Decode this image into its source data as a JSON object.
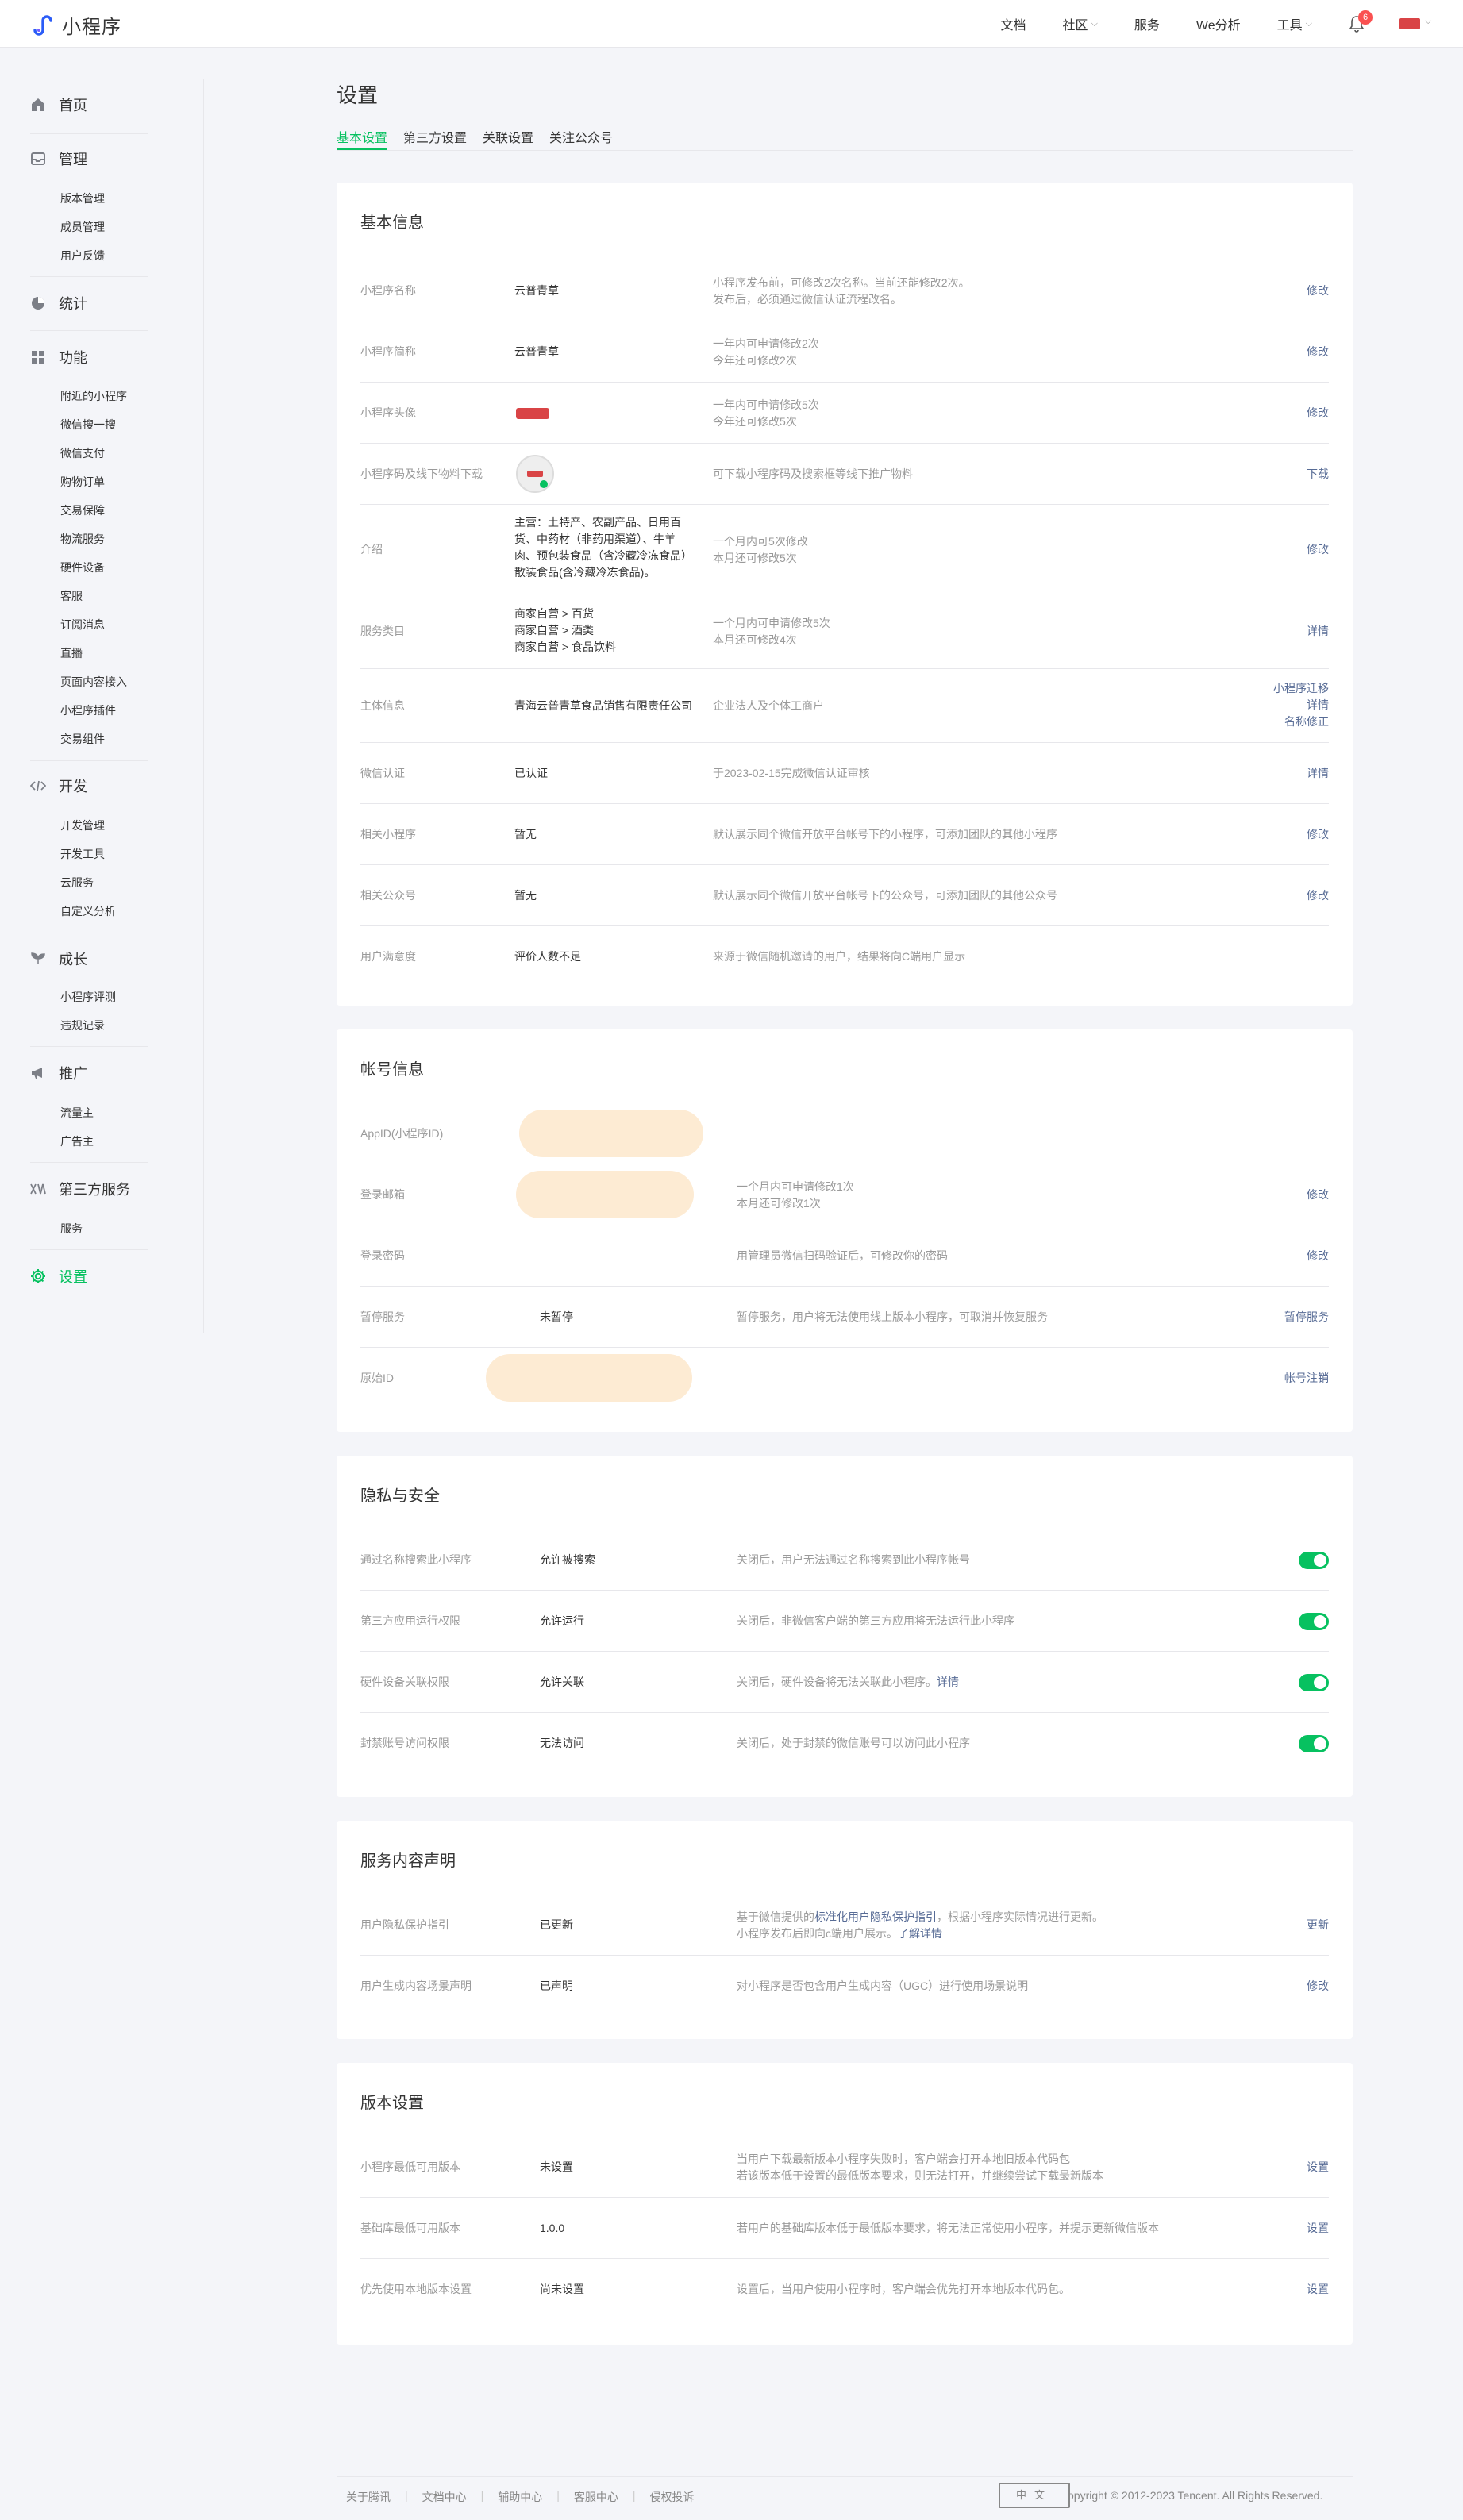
{
  "app": {
    "title": "小程序"
  },
  "topnav": {
    "items": [
      "文档",
      "社区",
      "服务",
      "We分析",
      "工具"
    ],
    "notifications": "6"
  },
  "sidebar": {
    "groups": [
      {
        "label": "首页",
        "icon": "home-icon",
        "items": []
      },
      {
        "label": "管理",
        "icon": "inbox-icon",
        "items": [
          "版本管理",
          "成员管理",
          "用户反馈"
        ]
      },
      {
        "label": "统计",
        "icon": "pie-chart-icon",
        "items": []
      },
      {
        "label": "功能",
        "icon": "grid-icon",
        "items": [
          "附近的小程序",
          "微信搜一搜",
          "微信支付",
          "购物订单",
          "交易保障",
          "物流服务",
          "硬件设备",
          "客服",
          "订阅消息",
          "直播",
          "页面内容接入",
          "小程序插件",
          "交易组件"
        ]
      },
      {
        "label": "开发",
        "icon": "code-icon",
        "items": [
          "开发管理",
          "开发工具",
          "云服务",
          "自定义分析"
        ]
      },
      {
        "label": "成长",
        "icon": "sprout-icon",
        "items": [
          "小程序评测",
          "违规记录"
        ]
      },
      {
        "label": "推广",
        "icon": "megaphone-icon",
        "items": [
          "流量主",
          "广告主"
        ]
      },
      {
        "label": "第三方服务",
        "icon": "puzzle-icon",
        "items": [
          "服务"
        ]
      },
      {
        "label": "设置",
        "icon": "gear-icon",
        "items": []
      }
    ]
  },
  "page": {
    "title": "设置",
    "tabs": [
      "基本设置",
      "第三方设置",
      "关联设置",
      "关注公众号"
    ]
  },
  "basic_info": {
    "title": "基本信息",
    "rows": [
      {
        "label": "小程序名称",
        "value": "云普青草",
        "desc": [
          "小程序发布前，可修改2次名称。当前还能修改2次。",
          "发布后，必须通过微信认证流程改名。"
        ],
        "actions": [
          "修改"
        ]
      },
      {
        "label": "小程序简称",
        "value": "云普青草",
        "desc": [
          "一年内可申请修改2次",
          "今年还可修改2次"
        ],
        "actions": [
          "修改"
        ]
      },
      {
        "label": "小程序头像",
        "value": "",
        "desc": [
          "一年内可申请修改5次",
          "今年还可修改5次"
        ],
        "actions": [
          "修改"
        ]
      },
      {
        "label": "小程序码及线下物料下载",
        "value": "",
        "desc": [
          "可下载小程序码及搜索框等线下推广物料"
        ],
        "actions": [
          "下载"
        ]
      },
      {
        "label": "介绍",
        "value": [
          "主营：土特产、农副产品、日用百",
          "货、中药材（非药用渠道）、牛羊",
          "肉、预包装食品（含冷藏冷冻食品）",
          "散装食品(含冷藏冷冻食品)。"
        ],
        "desc": [
          "一个月内可5次修改",
          "本月还可修改5次"
        ],
        "actions": [
          "修改"
        ]
      },
      {
        "label": "服务类目",
        "value": [
          "商家自营 > 百货",
          "商家自营 > 酒类",
          "商家自营 > 食品饮料"
        ],
        "desc": [
          "一个月内可申请修改5次",
          "本月还可修改4次"
        ],
        "actions": [
          "详情"
        ]
      },
      {
        "label": "主体信息",
        "value": "青海云普青草食品销售有限责任公司",
        "desc": [
          "企业法人及个体工商户"
        ],
        "actions": [
          "小程序迁移",
          "详情",
          "名称修正"
        ]
      },
      {
        "label": "微信认证",
        "value": "已认证",
        "desc": [
          "于2023-02-15完成微信认证审核"
        ],
        "actions": [
          "详情"
        ]
      },
      {
        "label": "相关小程序",
        "value": "暂无",
        "desc": [
          "默认展示同个微信开放平台帐号下的小程序，可添加团队的其他小程序"
        ],
        "actions": [
          "修改"
        ]
      },
      {
        "label": "相关公众号",
        "value": "暂无",
        "desc": [
          "默认展示同个微信开放平台帐号下的公众号，可添加团队的其他公众号"
        ],
        "actions": [
          "修改"
        ]
      },
      {
        "label": "用户满意度",
        "value": "评价人数不足",
        "desc": [
          "来源于微信随机邀请的用户，结果将向C端用户显示"
        ],
        "actions": []
      }
    ]
  },
  "account_info": {
    "title": "帐号信息",
    "rows": [
      {
        "label": "AppID(小程序ID)",
        "value": "",
        "desc": [],
        "action": ""
      },
      {
        "label": "登录邮箱",
        "value": "",
        "desc": [
          "一个月内可申请修改1次",
          "本月还可修改1次"
        ],
        "action": "修改"
      },
      {
        "label": "登录密码",
        "value": "",
        "desc": [
          "用管理员微信扫码验证后，可修改你的密码"
        ],
        "action": "修改"
      },
      {
        "label": "暂停服务",
        "value": "未暂停",
        "desc": [
          "暂停服务，用户将无法使用线上版本小程序，可取消并恢复服务"
        ],
        "action": "暂停服务"
      },
      {
        "label": "原始ID",
        "value": "",
        "desc": [],
        "action": "帐号注销"
      }
    ]
  },
  "privacy": {
    "title": "隐私与安全",
    "rows": [
      {
        "label": "通过名称搜索此小程序",
        "value": "允许被搜索",
        "desc": "关闭后，用户无法通过名称搜索到此小程序帐号",
        "link": ""
      },
      {
        "label": "第三方应用运行权限",
        "value": "允许运行",
        "desc": "关闭后，非微信客户端的第三方应用将无法运行此小程序",
        "link": ""
      },
      {
        "label": "硬件设备关联权限",
        "value": "允许关联",
        "desc": "关闭后，硬件设备将无法关联此小程序。",
        "link": "详情"
      },
      {
        "label": "封禁账号访问权限",
        "value": "无法访问",
        "desc": "关闭后，处于封禁的微信账号可以访问此小程序",
        "link": ""
      }
    ]
  },
  "service_decl": {
    "title": "服务内容声明",
    "rows": [
      {
        "label": "用户隐私保护指引",
        "value": "已更新",
        "desc_a": "基于微信提供的",
        "desc_link": "标准化用户隐私保护指引",
        "desc_b": "，根据小程序实际情况进行更新。",
        "desc_c": "小程序发布后即向c端用户展示。",
        "desc_link2": "了解详情",
        "action": "更新"
      },
      {
        "label": "用户生成内容场景声明",
        "value": "已声明",
        "desc_a": "对小程序是否包含用户生成内容（UGC）进行使用场景说明",
        "action": "修改"
      }
    ]
  },
  "version": {
    "title": "版本设置",
    "rows": [
      {
        "label": "小程序最低可用版本",
        "value": "未设置",
        "desc": [
          "当用户下载最新版本小程序失败时，客户端会打开本地旧版本代码包",
          "若该版本低于设置的最低版本要求，则无法打开，并继续尝试下载最新版本"
        ],
        "action": "设置"
      },
      {
        "label": "基础库最低可用版本",
        "value": "1.0.0",
        "desc": [
          "若用户的基础库版本低于最低版本要求，将无法正常使用小程序，并提示更新微信版本"
        ],
        "action": "设置"
      },
      {
        "label": "优先使用本地版本设置",
        "value": "尚未设置",
        "desc": [
          "设置后，当用户使用小程序时，客户端会优先打开本地版本代码包。"
        ],
        "action": "设置"
      }
    ]
  },
  "footer": {
    "links": [
      "关于腾讯",
      "文档中心",
      "辅助中心",
      "客服中心",
      "侵权投诉"
    ],
    "stamp": "中文",
    "copyright": "opyright © 2012-2023 Tencent. All Rights Reserved."
  },
  "colors": {
    "accent": "#07c160",
    "link": "#576b95",
    "badge": "#fa5151"
  }
}
